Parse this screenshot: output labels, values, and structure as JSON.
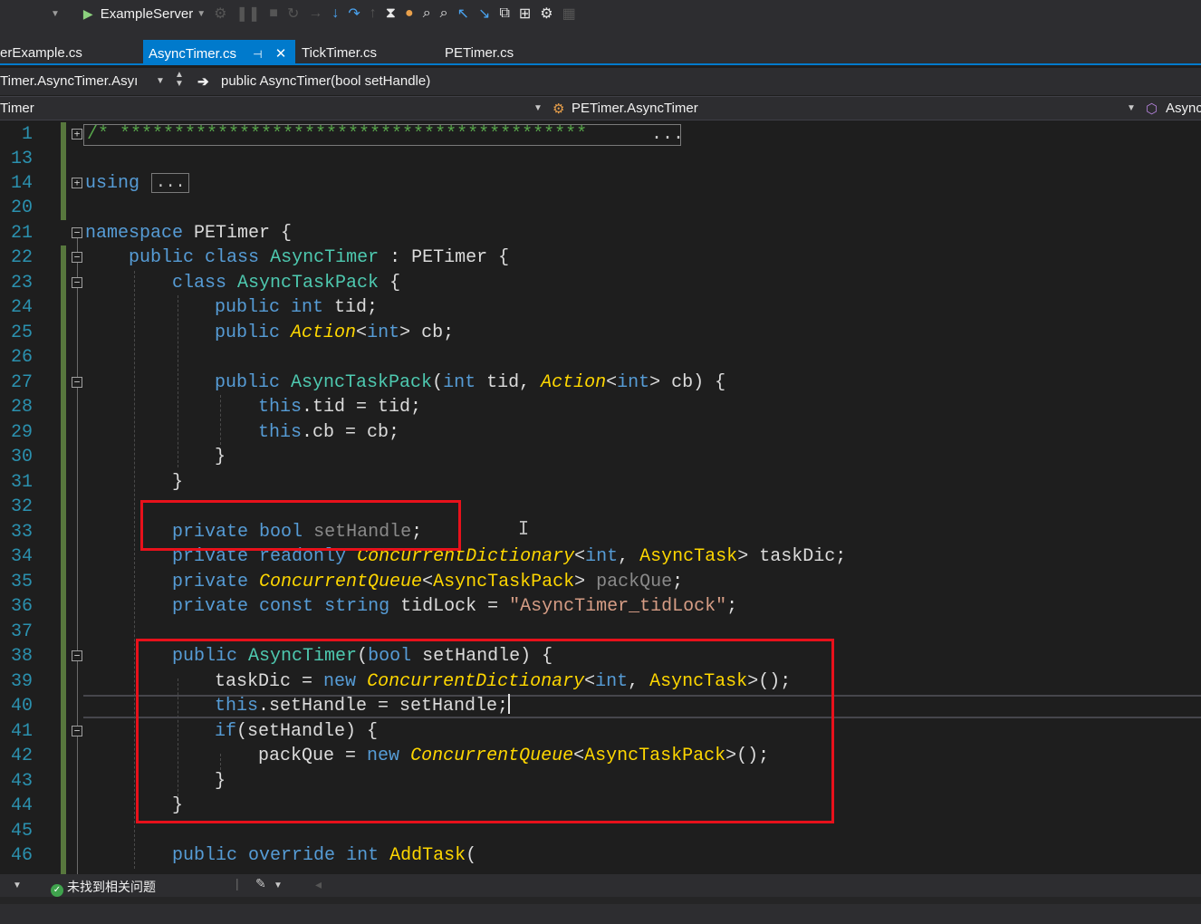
{
  "toolbar": {
    "target": "ExampleServer",
    "icons": [
      "start-icon",
      "attach-icon",
      "pause-icon",
      "stop-icon",
      "restart-icon",
      "show-next-statement-icon",
      "step-into-icon",
      "step-over-icon",
      "step-out-icon",
      "hot-reload-icon",
      "diagnostics-icon",
      "find-icon",
      "find-in-files-icon",
      "navigate-backward-icon",
      "navigate-forward-icon",
      "new-window-icon",
      "split-icon",
      "settings-icon",
      "layout-icon"
    ]
  },
  "tabs": [
    {
      "label": "erExample.cs",
      "active": false
    },
    {
      "label": "AsyncTimer.cs",
      "active": true,
      "pin": "⊣",
      "close": "✕"
    },
    {
      "label": "TickTimer.cs",
      "active": false
    },
    {
      "label": "PETimer.cs",
      "active": false
    }
  ],
  "nav": {
    "class_path": "Timer.AsyncTimer.Asyı",
    "member": "public AsyncTimer(bool setHandle)",
    "scope_left": "Timer",
    "type": "PETimer.AsyncTimer",
    "right": "Async"
  },
  "editor": {
    "line_numbers": [
      "1",
      "13",
      "14",
      "20",
      "21",
      "22",
      "23",
      "24",
      "25",
      "26",
      "27",
      "28",
      "29",
      "30",
      "31",
      "32",
      "33",
      "34",
      "35",
      "36",
      "37",
      "38",
      "39",
      "40",
      "41",
      "42",
      "43",
      "44",
      "45",
      "46"
    ],
    "collapsed_header": "...",
    "collapsed_using": "...",
    "header_comment": "/* *******************************************",
    "using_kw": "using",
    "line21": {
      "kw": "namespace",
      "rest": " PETimer {"
    },
    "line22": {
      "kw1": "public",
      "kw2": "class",
      "type": "AsyncTimer",
      "rest": " : PETimer {"
    },
    "line23": {
      "kw": "class",
      "type": "AsyncTaskPack",
      "rest": " {"
    },
    "line24": {
      "kw1": "public",
      "kw2": "int",
      "rest": " tid;"
    },
    "line25": {
      "kw": "public",
      "it": "Action",
      "p1": "<",
      "kw2": "int",
      "p2": "> cb;"
    },
    "line27": {
      "kw": "public",
      "type": "AsyncTaskPack",
      "p1": "(",
      "kw2": "int",
      "p2": " tid, ",
      "it": "Action",
      "p3": "<",
      "kw3": "int",
      "p4": "> cb) {"
    },
    "line28": {
      "kw": "this",
      "rest": ".tid = tid;"
    },
    "line29": {
      "kw": "this",
      "rest": ".cb = cb;"
    },
    "line30": "}",
    "line31": "}",
    "line33": {
      "kw1": "private",
      "kw2": "bool",
      "ident": "setHandle",
      "rest": ";"
    },
    "line34": {
      "kw1": "private",
      "kw2": "readonly",
      "it": "ConcurrentDictionary",
      "p1": "<",
      "kw3": "int",
      "p2": ", ",
      "fn": "AsyncTask",
      "p3": "> taskDic;"
    },
    "line35": {
      "kw": "private",
      "it": "ConcurrentQueue",
      "p1": "<",
      "fn": "AsyncTaskPack",
      "p2": "> ",
      "ident": "packQue",
      "p3": ";"
    },
    "line36": {
      "kw1": "private",
      "kw2": "const",
      "kw3": "string",
      "p1": " tidLock = ",
      "str": "\"AsyncTimer_tidLock\"",
      "p2": ";"
    },
    "line38": {
      "kw": "public",
      "type": "AsyncTimer",
      "p1": "(",
      "kw2": "bool",
      "p2": " setHandle) {"
    },
    "line39": {
      "p1": "taskDic = ",
      "kw": "new",
      "it": "ConcurrentDictionary",
      "p2": "<",
      "kw2": "int",
      "p3": ", ",
      "fn": "AsyncTask",
      "p4": ">();"
    },
    "line40": {
      "kw": "this",
      "rest": ".setHandle = setHandle;"
    },
    "line41": {
      "kw": "if",
      "rest": "(setHandle) {"
    },
    "line42": {
      "p1": "packQue = ",
      "kw": "new",
      "it": "ConcurrentQueue",
      "p2": "<",
      "fn": "AsyncTaskPack",
      "p3": ">();"
    },
    "line43": "}",
    "line44": "}",
    "line46": {
      "kw1": "public",
      "kw2": "override",
      "kw3": "int",
      "fn": "AddTask",
      "p1": "("
    }
  },
  "status": {
    "issues": "未找到相关问题"
  },
  "colors": {
    "background": "#1e1e1e",
    "keyword": "#569cd6",
    "type": "#4ec9b0",
    "highlight_box": "#e8111b",
    "line_number": "#2b91af",
    "active_tab": "#007acc"
  }
}
